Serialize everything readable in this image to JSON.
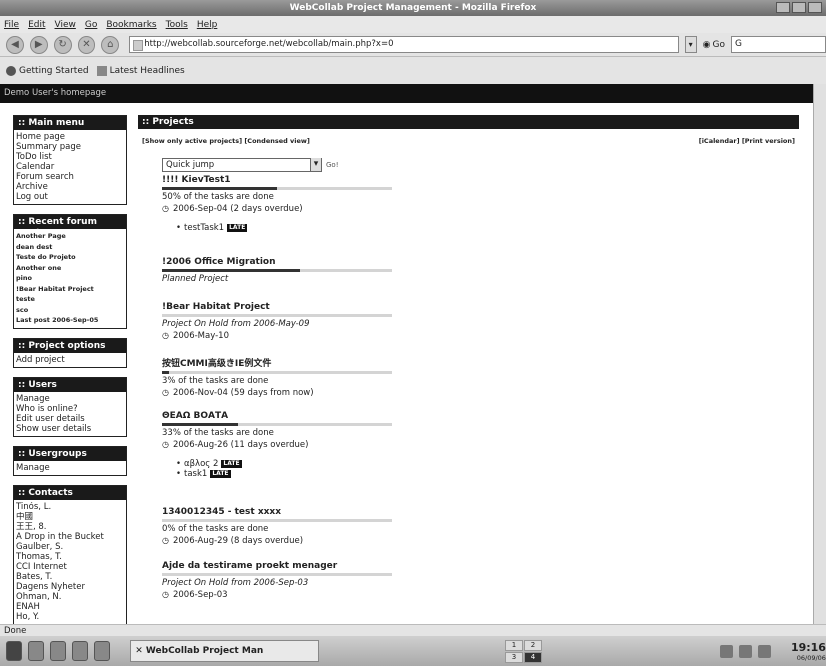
{
  "window": {
    "title": "WebCollab Project Management - Mozilla Firefox"
  },
  "menubar": {
    "items": [
      "File",
      "Edit",
      "View",
      "Go",
      "Bookmarks",
      "Tools",
      "Help"
    ]
  },
  "navbar": {
    "url": "http://webcollab.sourceforge.net/webcollab/main.php?x=0",
    "go_label": "Go",
    "search_value": ""
  },
  "bookmarks": {
    "items": [
      "Getting Started",
      "Latest Headlines"
    ]
  },
  "page": {
    "topbar_text": "Demo User's homepage",
    "main_menu": {
      "title": ":: Main menu",
      "items": [
        "Home page",
        "Summary page",
        "ToDo list",
        "Calendar",
        "Forum search",
        "Archive",
        "Log out"
      ]
    },
    "forum_posts": {
      "title": ":: Recent forum posts",
      "items": [
        "Another Page",
        "dean dest",
        "Teste do Projeto",
        "Another one",
        "pino",
        "!Bear Habitat Project",
        "teste",
        "sco",
        "Last post 2006-Sep-05"
      ]
    },
    "project_options": {
      "title": ":: Project options",
      "items": [
        "Add project"
      ]
    },
    "users": {
      "title": ":: Users",
      "items": [
        "Manage",
        "Who is online?",
        "Edit user details",
        "Show user details"
      ]
    },
    "usergroups": {
      "title": ":: Usergroups",
      "items": [
        "Manage"
      ]
    },
    "contacts": {
      "title": ":: Contacts",
      "items": [
        "Tinós, L.",
        "中國",
        "王王, 8.",
        "A Drop in the Bucket",
        "Gaulber, S.",
        "Thomas, T.",
        "CCI Internet",
        "Bates, T.",
        "Dagens Nyheter",
        "Ohman, N.",
        "ENAH",
        "Ho, Y."
      ]
    },
    "projects": {
      "title": ":: Projects",
      "left_links": "[Show only active projects] [Condensed view]",
      "right_links": "[iCalendar] [Print version]",
      "quick_jump": "Quick jump",
      "go_label": "Go!",
      "list": [
        {
          "title": "!!!! KievTest1",
          "progress": 50,
          "status": "50% of the tasks are done",
          "date": "2006-Sep-04 (2 days overdue)",
          "tasks": [
            {
              "name": "testTask1",
              "badge": "LATE"
            }
          ]
        },
        {
          "title": "!2006 Office Migration",
          "progress": 60,
          "status": "Planned Project",
          "date": "",
          "tasks": []
        },
        {
          "title": "!Bear Habitat Project",
          "progress": 0,
          "status": "Project On Hold from 2006-May-09",
          "date": "2006-May-10",
          "tasks": []
        },
        {
          "title": "按钮CMMI高级きIE例文件",
          "progress": 3,
          "status": "3% of the tasks are done",
          "date": "2006-Nov-04 (59 days from now)",
          "tasks": []
        },
        {
          "title": "ΘΕΑΩ ΒΟΑΤΑ",
          "progress": 33,
          "status": "33% of the tasks are done",
          "date": "2006-Aug-26 (11 days overdue)",
          "tasks": [
            {
              "name": "αβλος 2",
              "badge": "LATE"
            },
            {
              "name": "task1",
              "badge": "LATE"
            }
          ]
        },
        {
          "title": "1340012345 - test xxxx",
          "progress": 0,
          "status": "0% of the tasks are done",
          "date": "2006-Aug-29 (8 days overdue)",
          "tasks": []
        },
        {
          "title": "Ajde da testirame proekt menager",
          "progress": 0,
          "status": "Project On Hold from 2006-Sep-03",
          "date": "2006-Sep-03",
          "tasks": []
        }
      ]
    }
  },
  "statusbar": {
    "text": "Done"
  },
  "taskbar": {
    "task_label": "WebCollab Project Man",
    "pager": [
      "1",
      "2",
      "3",
      "4"
    ],
    "time": "19:16",
    "date": "06/09/06"
  }
}
